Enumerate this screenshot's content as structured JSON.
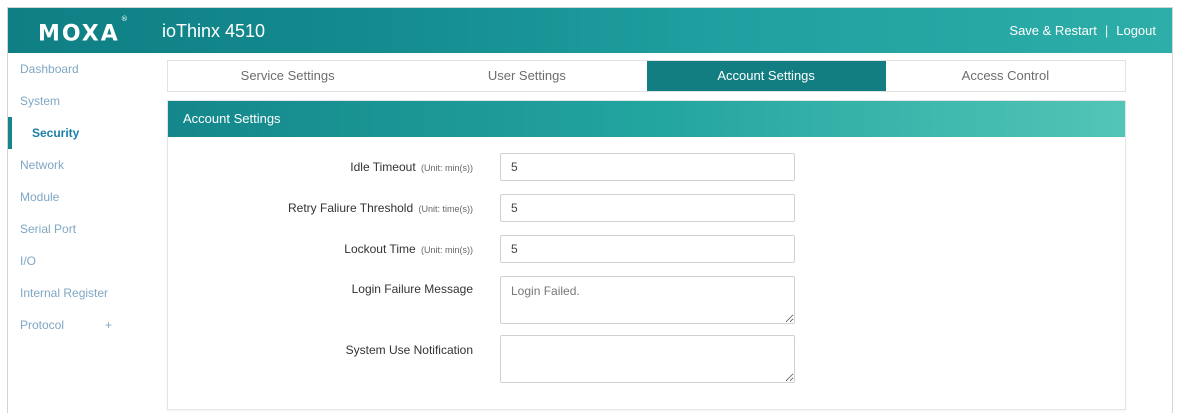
{
  "header": {
    "logo": "MOXA",
    "logo_mark": "®",
    "product": "ioThinx 4510",
    "save_restart": "Save & Restart",
    "separator": "|",
    "logout": "Logout",
    "accent_color": "#137e82"
  },
  "sidebar": {
    "items": [
      {
        "label": "Dashboard"
      },
      {
        "label": "System"
      },
      {
        "label": "Security",
        "active": true
      },
      {
        "label": "Network"
      },
      {
        "label": "Module"
      },
      {
        "label": "Serial Port"
      },
      {
        "label": "I/O"
      },
      {
        "label": "Internal Register"
      },
      {
        "label": "Protocol",
        "expand": "+"
      }
    ]
  },
  "tabs": [
    {
      "label": "Service Settings"
    },
    {
      "label": "User Settings"
    },
    {
      "label": "Account Settings",
      "active": true
    },
    {
      "label": "Access Control"
    }
  ],
  "panel": {
    "title": "Account Settings",
    "fields": [
      {
        "label": "Idle Timeout",
        "unit": "(Unit: min(s))",
        "value": "5"
      },
      {
        "label": "Retry Faliure Threshold",
        "unit": "(Unit: time(s))",
        "value": "5"
      },
      {
        "label": "Lockout Time",
        "unit": "(Unit: min(s))",
        "value": "5"
      },
      {
        "label": "Login Failure Message",
        "value": "Login Failed."
      },
      {
        "label": "System Use Notification",
        "value": ""
      }
    ]
  }
}
